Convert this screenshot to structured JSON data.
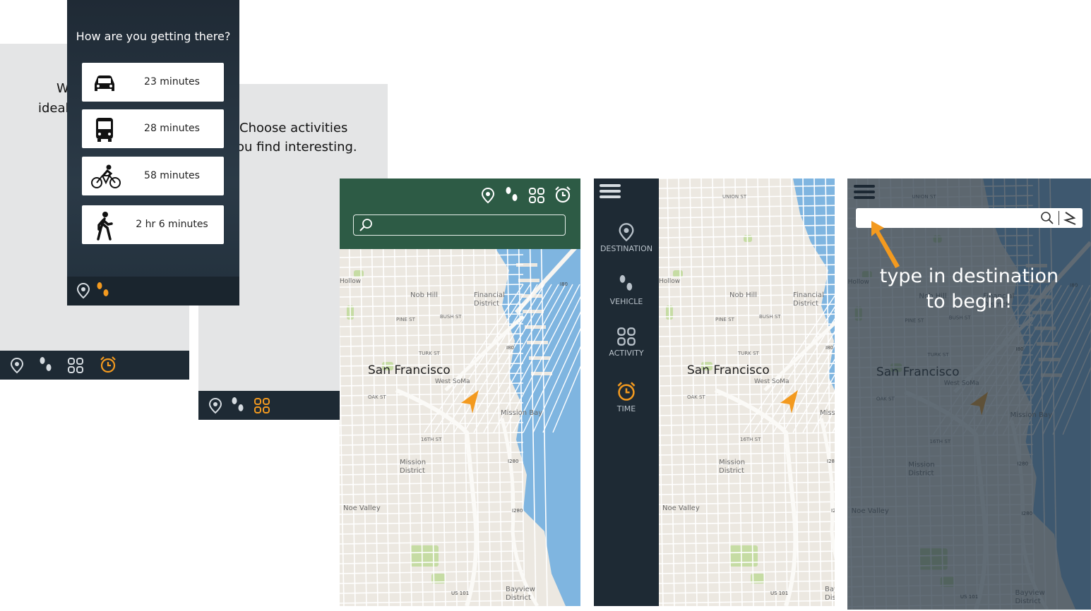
{
  "screen1": {
    "text_line1": "W",
    "text_line2": "ideal",
    "bottom_icons": [
      "pin-icon",
      "footprints-icon",
      "grid-icon",
      "alarm-clock-icon"
    ]
  },
  "screen2": {
    "title": "How are you getting there?",
    "options": [
      {
        "icon": "car-icon",
        "label": "23 minutes"
      },
      {
        "icon": "bus-icon",
        "label": "28 minutes"
      },
      {
        "icon": "bike-icon",
        "label": "58 minutes"
      },
      {
        "icon": "walk-icon",
        "label": "2 hr 6 minutes"
      }
    ],
    "bottom_icons": [
      "pin-icon",
      "footprints-icon"
    ]
  },
  "screen3": {
    "text_line1": "Choose activities",
    "text_line2": "ou find interesting.",
    "bottom_icons": [
      "pin-icon",
      "footprints-icon",
      "grid-icon"
    ]
  },
  "map_labels": {
    "city": "San Francisco",
    "union_st": "UNION ST",
    "nob_hill": "Nob Hill",
    "financial": "Financial\nDistrict",
    "pine_st": "PINE ST",
    "bush_st": "BUSH ST",
    "turk_st": "TURK ST",
    "oak_st": "OAK ST",
    "west_soma": "West SoMa",
    "mission_bay": "Mission Bay",
    "sixteenth": "16TH ST",
    "mission_district": "Mission\nDistrict",
    "noe_valley": "Noe Valley",
    "bayview": "Bayview\nDistrict",
    "hollow": "Hollow",
    "i80": "I80",
    "i280": "I280",
    "us101": "US 101"
  },
  "screen4": {
    "header_color": "#2d5b45",
    "search_placeholder": ""
  },
  "screen5": {
    "menu": [
      {
        "icon": "pin-icon",
        "label": "DESTINATION"
      },
      {
        "icon": "footprints-icon",
        "label": "VEHICLE"
      },
      {
        "icon": "grid-icon",
        "label": "ACTIVITY"
      },
      {
        "icon": "alarm-clock-icon",
        "label": "TIME"
      }
    ]
  },
  "screen6": {
    "hint_line1": "type in destination",
    "hint_line2": "to begin!",
    "search_placeholder": ""
  },
  "colors": {
    "accent": "#f39a1f",
    "dark_bar": "#1e2a34",
    "water": "#7fb5e0",
    "park": "#c6dca4"
  }
}
